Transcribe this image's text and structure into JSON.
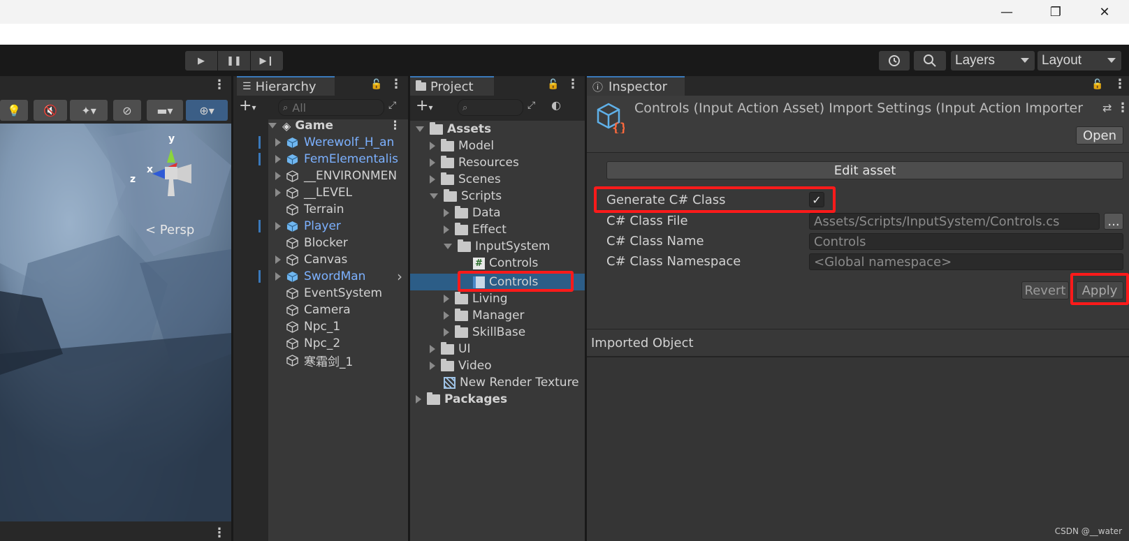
{
  "window": {
    "minimize": "—",
    "maximize": "❐",
    "close": "✕"
  },
  "toolbar": {
    "play": "▶",
    "pause": "❚❚",
    "step": "▶❙",
    "layers_label": "Layers",
    "layout_label": "Layout"
  },
  "scene": {
    "gizmo_y": "y",
    "gizmo_x": "x",
    "gizmo_z": "z",
    "persp_label": "< Persp"
  },
  "hierarchy": {
    "tab_label": "Hierarchy",
    "search_placeholder": "All",
    "root": "Game",
    "items": [
      {
        "label": "Werewolf_H_an",
        "prefab": true,
        "expandable": true
      },
      {
        "label": "FemElementalis",
        "prefab": true,
        "expandable": true
      },
      {
        "label": "__ENVIRONMEN",
        "prefab": false,
        "expandable": true
      },
      {
        "label": "__LEVEL",
        "prefab": false,
        "expandable": true
      },
      {
        "label": "Terrain",
        "prefab": false,
        "expandable": false
      },
      {
        "label": "Player",
        "prefab": true,
        "expandable": true
      },
      {
        "label": "Blocker",
        "prefab": false,
        "expandable": false
      },
      {
        "label": "Canvas",
        "prefab": false,
        "expandable": true
      },
      {
        "label": "SwordMan",
        "prefab": true,
        "expandable": true
      },
      {
        "label": "EventSystem",
        "prefab": false,
        "expandable": false
      },
      {
        "label": "Camera",
        "prefab": false,
        "expandable": false
      },
      {
        "label": "Npc_1",
        "prefab": false,
        "expandable": false
      },
      {
        "label": "Npc_2",
        "prefab": false,
        "expandable": false
      },
      {
        "label": "寒霜剑_1",
        "prefab": false,
        "expandable": false
      }
    ]
  },
  "project": {
    "tab_label": "Project",
    "tree": {
      "assets": "Assets",
      "model": "Model",
      "resources": "Resources",
      "scenes": "Scenes",
      "scripts": "Scripts",
      "data": "Data",
      "effect": "Effect",
      "inputsystem": "InputSystem",
      "controls_cs": "Controls",
      "controls_asset": "Controls",
      "living": "Living",
      "manager": "Manager",
      "skillbase": "SkillBase",
      "ui": "UI",
      "video": "Video",
      "render_texture": "New Render Texture",
      "packages": "Packages"
    }
  },
  "inspector": {
    "tab_label": "Inspector",
    "title": "Controls (Input Action Asset) Import Settings (Input Action Importer",
    "open_button": "Open",
    "edit_asset_button": "Edit asset",
    "generate_label": "Generate C# Class",
    "generate_checked": "✓",
    "class_file_label": "C# Class File",
    "class_file_value": "Assets/Scripts/InputSystem/Controls.cs",
    "class_file_browse": "...",
    "class_name_label": "C# Class Name",
    "class_name_value": "Controls",
    "namespace_label": "C# Class Namespace",
    "namespace_value": "<Global namespace>",
    "revert_button": "Revert",
    "apply_button": "Apply",
    "imported_object_label": "Imported Object"
  },
  "watermark": "CSDN @__water",
  "colors": {
    "accent_blue": "#3a79bb",
    "selection": "#2c5d87",
    "highlight_red": "#ff1a1a",
    "prefab_blue": "#7cb1ff"
  }
}
